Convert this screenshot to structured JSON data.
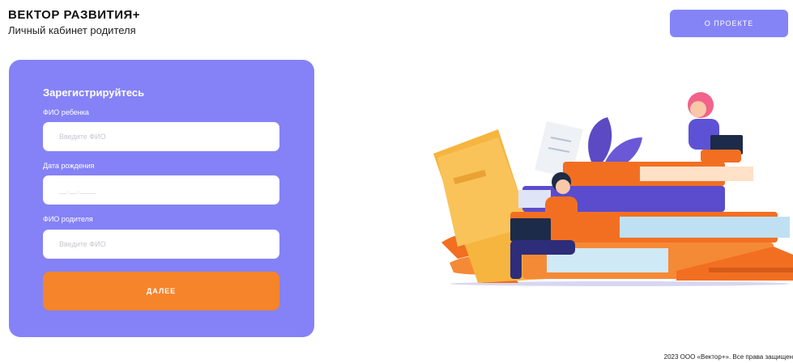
{
  "header": {
    "brand_title": "ВЕКТОР РАЗВИТИЯ+",
    "brand_subtitle": "Личный кабинет родителя",
    "about_button": "О ПРОЕКТЕ"
  },
  "form": {
    "title": "Зарегистрируйтесь",
    "child_name_label": "ФИО ребенка",
    "child_name_placeholder": "Введите ФИО",
    "birth_date_label": "Дата рождения",
    "birth_date_placeholder": "__.__.____",
    "parent_name_label": "ФИО родителя",
    "parent_name_placeholder": "Введите ФИО",
    "submit_label": "ДАЛЕЕ"
  },
  "footer": {
    "copyright": "2023 ООО «Вектор+». Все права защищен"
  },
  "colors": {
    "accent_purple": "#8482f6",
    "accent_orange": "#f6842b"
  },
  "illustration": {
    "icon": "students-on-books-illustration"
  }
}
